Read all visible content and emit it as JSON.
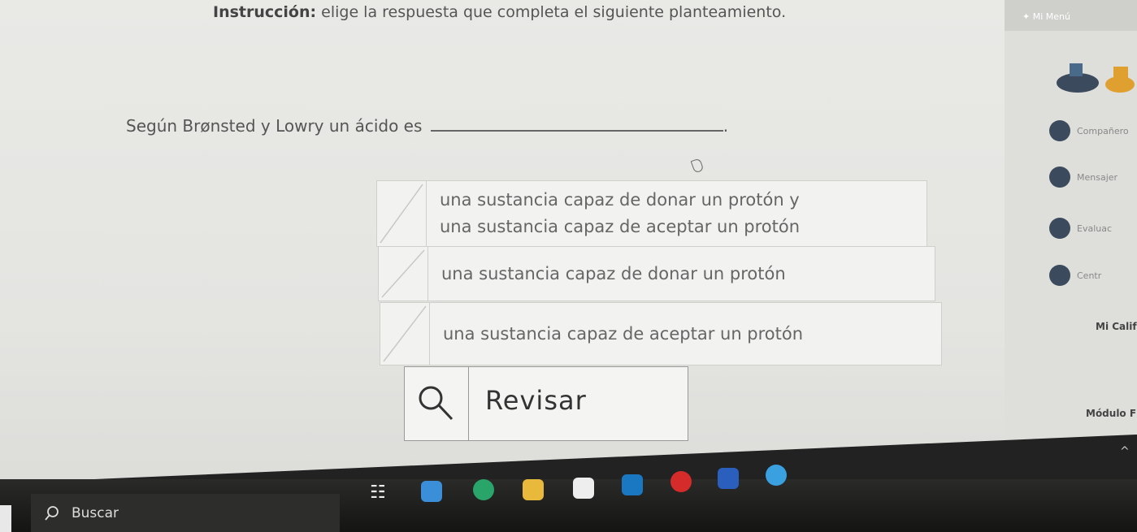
{
  "instruction": {
    "label": "Instrucción:",
    "text": " elige la respuesta que completa el siguiente planteamiento."
  },
  "question": {
    "text": "Según Brønsted y Lowry un ácido es",
    "end": "."
  },
  "options": [
    {
      "text": "una sustancia capaz de donar un protón y una sustancia capaz de aceptar un protón"
    },
    {
      "text": "una sustancia capaz de donar un protón"
    },
    {
      "text": "una sustancia capaz de aceptar un protón"
    }
  ],
  "review_button": {
    "label": "Revisar"
  },
  "sidebar": {
    "menu_title": "Mi Menú",
    "items": [
      {
        "label": "Compañero"
      },
      {
        "label": "Mensajer"
      },
      {
        "label": "Evaluac"
      },
      {
        "label": "Centr"
      }
    ],
    "grades_label": "Mi Calif",
    "module_label": "Módulo F"
  },
  "taskbar": {
    "search_label": "Buscar"
  },
  "colors": {
    "accent_navy": "#3b4a5c",
    "accent_gold": "#e0a030"
  }
}
